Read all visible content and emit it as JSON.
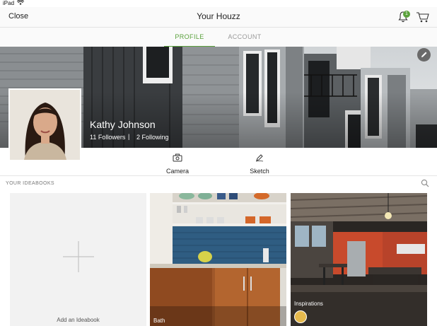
{
  "status_bar": {
    "carrier": "iPad"
  },
  "header": {
    "close_label": "Close",
    "title": "Your Houzz",
    "notification_count": "1"
  },
  "tabs": [
    {
      "label": "PROFILE",
      "active": true
    },
    {
      "label": "ACCOUNT",
      "active": false
    }
  ],
  "profile": {
    "name": "Kathy Johnson",
    "followers": "11 Followers",
    "following": "2 Following",
    "separator": "|"
  },
  "actions": [
    {
      "label": "Camera",
      "icon": "camera-icon"
    },
    {
      "label": "Sketch",
      "icon": "sketch-icon"
    }
  ],
  "ideabooks": {
    "section_label": "YOUR IDEABOOKS",
    "add_label": "Add an Ideabook",
    "items": [
      {
        "label": "Bath"
      },
      {
        "label": "Inspirations"
      }
    ]
  },
  "colors": {
    "accent": "#5aa13c"
  }
}
